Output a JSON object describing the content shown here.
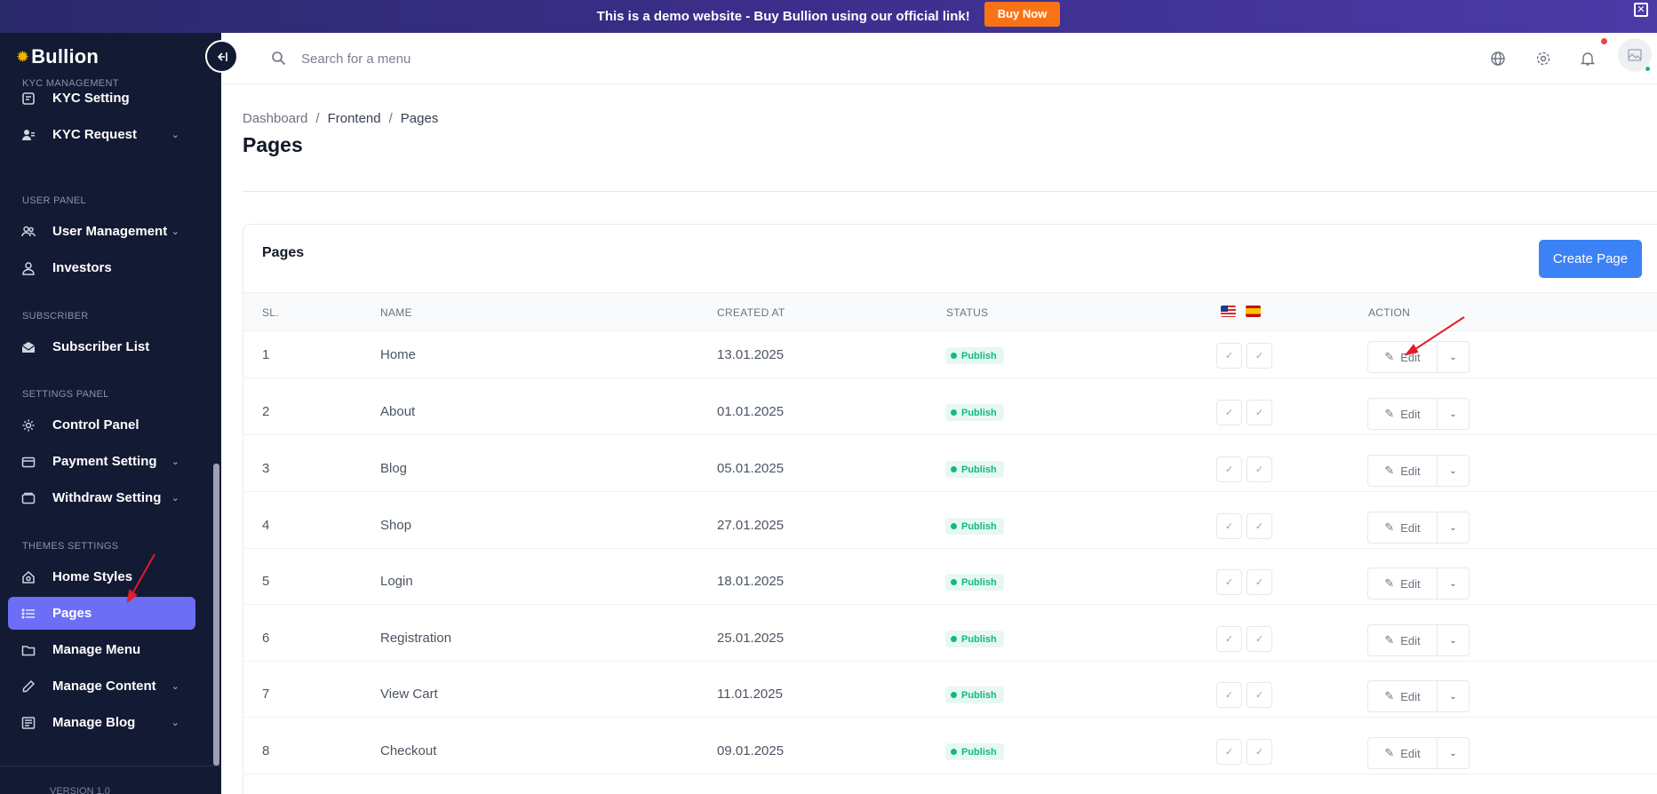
{
  "promo": {
    "text": "This is a demo website - Buy Bullion using our official link!",
    "button": "Buy Now"
  },
  "brand": {
    "name_prefix": "Bul",
    "name_suffix": "lion",
    "accent": "#f5b400"
  },
  "sidebar": {
    "sections": [
      {
        "label": "KYC MANAGEMENT"
      },
      {
        "label": "USER PANEL"
      },
      {
        "label": "SUBSCRIBER"
      },
      {
        "label": "SETTINGS PANEL"
      },
      {
        "label": "THEMES SETTINGS"
      }
    ],
    "items": [
      {
        "label": "KYC Setting",
        "icon": "kyc-setting-icon"
      },
      {
        "label": "KYC Request",
        "icon": "kyc-request-icon"
      },
      {
        "label": "User Management",
        "icon": "users-icon"
      },
      {
        "label": "Investors",
        "icon": "investor-icon"
      },
      {
        "label": "Subscriber List",
        "icon": "mail-icon"
      },
      {
        "label": "Control Panel",
        "icon": "gear-icon"
      },
      {
        "label": "Payment Setting",
        "icon": "wallet-icon"
      },
      {
        "label": "Withdraw Setting",
        "icon": "withdraw-icon"
      },
      {
        "label": "Home Styles",
        "icon": "home-icon"
      },
      {
        "label": "Pages",
        "icon": "list-icon"
      },
      {
        "label": "Manage Menu",
        "icon": "folder-icon"
      },
      {
        "label": "Manage Content",
        "icon": "pencil-icon"
      },
      {
        "label": "Manage Blog",
        "icon": "blog-icon"
      }
    ],
    "active_color": "#6c6ef6",
    "version": "VERSION 1.0"
  },
  "header": {
    "search_placeholder": "Search for a menu"
  },
  "breadcrumb": [
    "Dashboard",
    "Frontend",
    "Pages"
  ],
  "page_title": "Pages",
  "card": {
    "title": "Pages",
    "create_button": "Create Page",
    "columns": {
      "sl": "SL.",
      "name": "NAME",
      "created_at": "CREATED AT",
      "status": "STATUS",
      "action": "ACTION"
    },
    "rows": [
      {
        "sl": "1",
        "name": "Home",
        "created_at": "13.01.2025",
        "status": "Publish",
        "edit": "Edit"
      },
      {
        "sl": "2",
        "name": "About",
        "created_at": "01.01.2025",
        "status": "Publish",
        "edit": "Edit"
      },
      {
        "sl": "3",
        "name": "Blog",
        "created_at": "05.01.2025",
        "status": "Publish",
        "edit": "Edit"
      },
      {
        "sl": "4",
        "name": "Shop",
        "created_at": "27.01.2025",
        "status": "Publish",
        "edit": "Edit"
      },
      {
        "sl": "5",
        "name": "Login",
        "created_at": "18.01.2025",
        "status": "Publish",
        "edit": "Edit"
      },
      {
        "sl": "6",
        "name": "Registration",
        "created_at": "25.01.2025",
        "status": "Publish",
        "edit": "Edit"
      },
      {
        "sl": "7",
        "name": "View Cart",
        "created_at": "11.01.2025",
        "status": "Publish",
        "edit": "Edit"
      },
      {
        "sl": "8",
        "name": "Checkout",
        "created_at": "09.01.2025",
        "status": "Publish",
        "edit": "Edit"
      }
    ]
  }
}
